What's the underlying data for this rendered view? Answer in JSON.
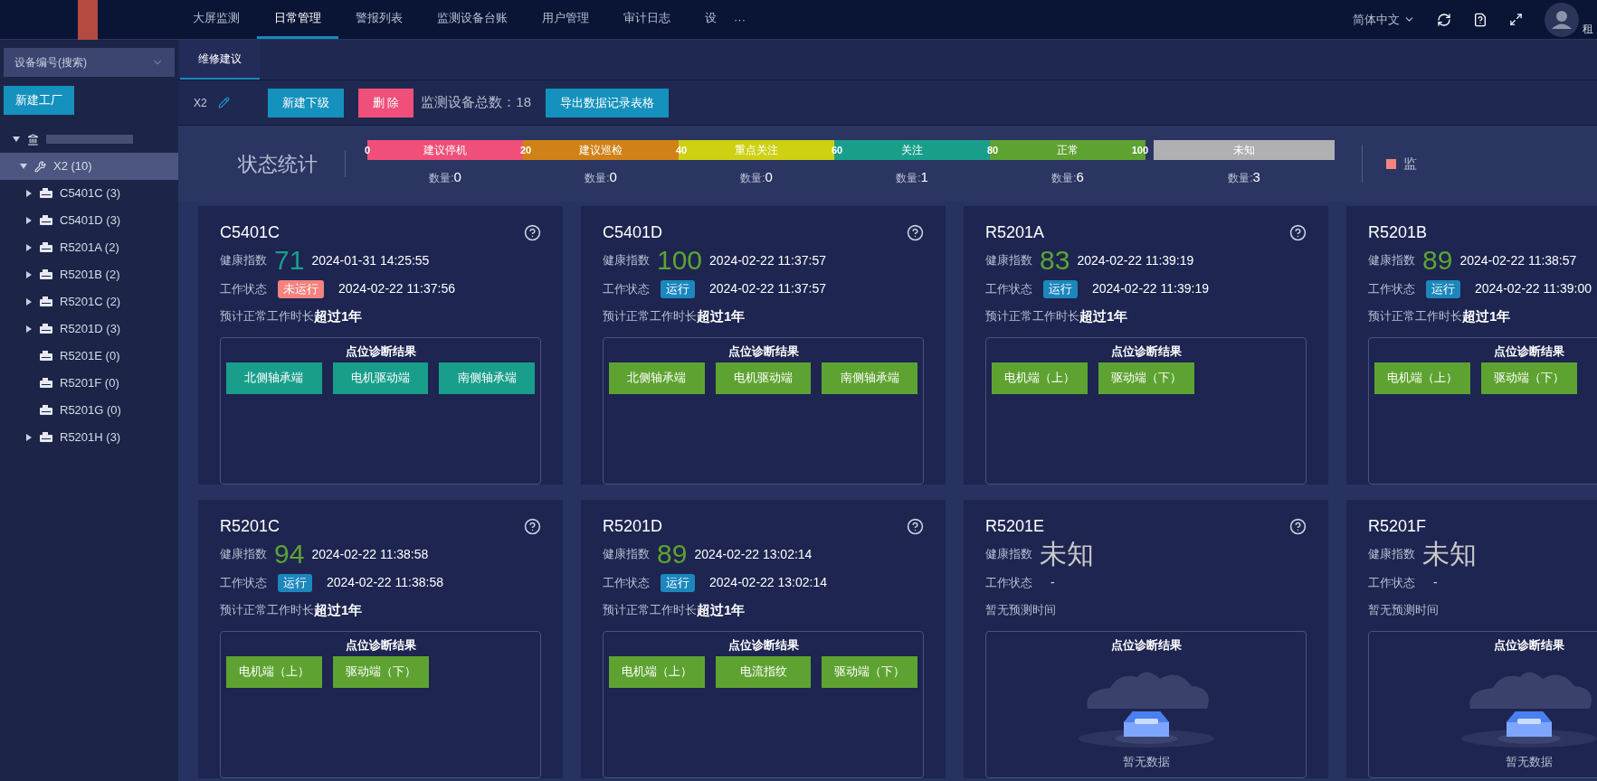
{
  "header": {
    "nav": [
      {
        "label": "大屏监测",
        "selected": false
      },
      {
        "label": "日常管理",
        "selected": true
      },
      {
        "label": "警报列表",
        "selected": false
      },
      {
        "label": "监测设备台账",
        "selected": false
      },
      {
        "label": "用户管理",
        "selected": false
      },
      {
        "label": "审计日志",
        "selected": false
      },
      {
        "label": "设",
        "selected": false
      }
    ],
    "more": "···",
    "language": "简体中文",
    "user": "租"
  },
  "sidebar": {
    "search": {
      "placeholder": "设备编号(搜索)"
    },
    "new_button": "新建工厂",
    "tree": [
      {
        "kind": "site",
        "expanded": true,
        "selected": false,
        "children": [
          {
            "kind": "group",
            "label": "X2 (10)",
            "expanded": true,
            "selected": true,
            "children": [
              {
                "kind": "device",
                "label": "C5401C (3)",
                "expanded": false,
                "selected": false
              },
              {
                "kind": "device",
                "label": "C5401D (3)",
                "expanded": false,
                "selected": false
              },
              {
                "kind": "device",
                "label": "R5201A (2)",
                "expanded": false,
                "selected": false
              },
              {
                "kind": "device",
                "label": "R5201B (2)",
                "expanded": false,
                "selected": false
              },
              {
                "kind": "device",
                "label": "R5201C (2)",
                "expanded": false,
                "selected": false
              },
              {
                "kind": "device",
                "label": "R5201D (3)",
                "expanded": false,
                "selected": false
              },
              {
                "kind": "device",
                "label": "R5201E (0)",
                "selected": false
              },
              {
                "kind": "device",
                "label": "R5201F (0)",
                "selected": false
              },
              {
                "kind": "device",
                "label": "R5201G (0)",
                "selected": false
              },
              {
                "kind": "device",
                "label": "R5201H (3)",
                "expanded": false,
                "selected": false
              }
            ]
          }
        ]
      }
    ]
  },
  "tabs": [
    {
      "label": "维修建议",
      "selected": true
    }
  ],
  "toolbar": {
    "name": "X2",
    "new_child": "新建下级",
    "delete": "删 除",
    "total": "监测设备总数：18",
    "export": "导出数据记录表格"
  },
  "stats": {
    "title": "状态统计",
    "ticks": [
      "0",
      "20",
      "40",
      "60",
      "80",
      "100"
    ],
    "segments": [
      {
        "label": "建议停机",
        "color": "#ef4f78",
        "count_label": "数量:",
        "count": "0"
      },
      {
        "label": "建议巡检",
        "color": "#d08216",
        "count_label": "数量:",
        "count": "0"
      },
      {
        "label": "重点关注",
        "color": "#cdd112",
        "count_label": "数量:",
        "count": "0"
      },
      {
        "label": "关注",
        "color": "#1a9e8c",
        "count_label": "数量:",
        "count": "1"
      },
      {
        "label": "正常",
        "color": "#5ea331",
        "count_label": "数量:",
        "count": "6"
      }
    ],
    "unknown": {
      "label": "未知",
      "color": "#b0b0b2",
      "count_label": "数量:",
      "count": "3"
    },
    "legend": {
      "label": "监",
      "color": "#f4827e"
    }
  },
  "cards": [
    {
      "title": "C5401C",
      "help": true,
      "health_label": "健康指数",
      "score": "71",
      "color": "#1a9e8c",
      "score_time": "2024-01-31 14:25:55",
      "status_label": "工作状态",
      "status": {
        "kind": "stopped",
        "label": "未运行"
      },
      "status_time": "2024-02-22 11:37:56",
      "forecast_label": "预计正常工作时长",
      "forecast_value": "超过1年",
      "diag_title": "点位诊断结果",
      "points": [
        "北侧轴承端",
        "电机驱动端",
        "南侧轴承端"
      ]
    },
    {
      "title": "C5401D",
      "help": true,
      "health_label": "健康指数",
      "score": "100",
      "color": "#5ea331",
      "score_time": "2024-02-22 11:37:57",
      "status_label": "工作状态",
      "status": {
        "kind": "running",
        "label": "运行"
      },
      "status_time": "2024-02-22 11:37:57",
      "forecast_label": "预计正常工作时长",
      "forecast_value": "超过1年",
      "diag_title": "点位诊断结果",
      "points": [
        "北侧轴承端",
        "电机驱动端",
        "南侧轴承端"
      ]
    },
    {
      "title": "R5201A",
      "help": true,
      "health_label": "健康指数",
      "score": "83",
      "color": "#5ea331",
      "score_time": "2024-02-22 11:39:19",
      "status_label": "工作状态",
      "status": {
        "kind": "running",
        "label": "运行"
      },
      "status_time": "2024-02-22 11:39:19",
      "forecast_label": "预计正常工作时长",
      "forecast_value": "超过1年",
      "diag_title": "点位诊断结果",
      "points": [
        "电机端（上）",
        "驱动端（下）"
      ]
    },
    {
      "title": "R5201B",
      "help": false,
      "health_label": "健康指数",
      "score": "89",
      "color": "#5ea331",
      "score_time": "2024-02-22 11:38:57",
      "status_label": "工作状态",
      "status": {
        "kind": "running",
        "label": "运行"
      },
      "status_time": "2024-02-22 11:39:00",
      "forecast_label": "预计正常工作时长",
      "forecast_value": "超过1年",
      "diag_title": "点位诊断结果",
      "points": [
        "电机端（上）",
        "驱动端（下）"
      ]
    },
    {
      "title": "R5201C",
      "help": true,
      "health_label": "健康指数",
      "score": "94",
      "color": "#5ea331",
      "score_time": "2024-02-22 11:38:58",
      "status_label": "工作状态",
      "status": {
        "kind": "running",
        "label": "运行"
      },
      "status_time": "2024-02-22 11:38:58",
      "forecast_label": "预计正常工作时长",
      "forecast_value": "超过1年",
      "diag_title": "点位诊断结果",
      "points": [
        "电机端（上）",
        "驱动端（下）"
      ]
    },
    {
      "title": "R5201D",
      "help": true,
      "health_label": "健康指数",
      "score": "89",
      "color": "#5ea331",
      "score_time": "2024-02-22 13:02:14",
      "status_label": "工作状态",
      "status": {
        "kind": "running",
        "label": "运行"
      },
      "status_time": "2024-02-22 13:02:14",
      "forecast_label": "预计正常工作时长",
      "forecast_value": "超过1年",
      "diag_title": "点位诊断结果",
      "points": [
        "电机端（上）",
        "电流指纹",
        "驱动端（下）"
      ]
    },
    {
      "title": "R5201E",
      "help": true,
      "health_label": "健康指数",
      "score": "未知",
      "color": "#c8c8c8",
      "status_label": "工作状态",
      "status": {
        "kind": "plain",
        "label": "-"
      },
      "forecast_note": "暂无预测时间",
      "diag_title": "点位诊断结果",
      "empty": "暂无数据"
    },
    {
      "title": "R5201F",
      "help": false,
      "health_label": "健康指数",
      "score": "未知",
      "color": "#c8c8c8",
      "status_label": "工作状态",
      "status": {
        "kind": "plain",
        "label": "-"
      },
      "forecast_note": "暂无预测时间",
      "diag_title": "点位诊断结果",
      "empty": "暂无数据"
    }
  ]
}
